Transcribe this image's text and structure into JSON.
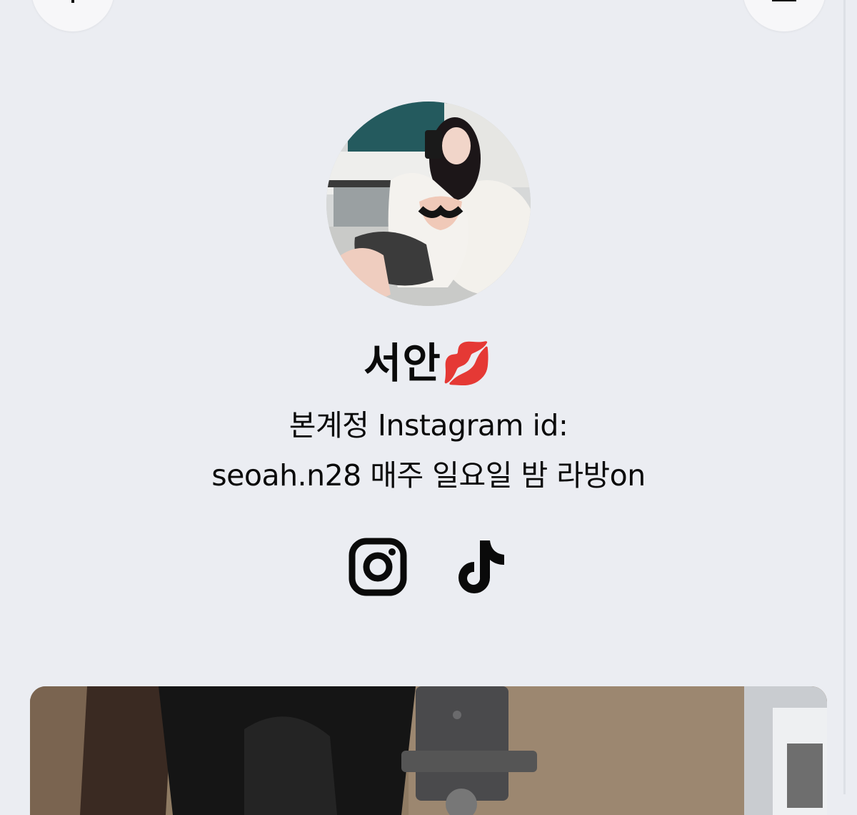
{
  "profile": {
    "display_name": "서안💋",
    "bio_line_1": "본계정 Instagram id:",
    "bio_line_2": "seoah.n28 매주 일요일 밤 라방on"
  },
  "socials": [
    {
      "icon": "instagram-icon"
    },
    {
      "icon": "tiktok-icon"
    }
  ],
  "colors": {
    "page_background": "#ebedf2",
    "text": "#0a0a0a",
    "button_background": "#f7f7f9"
  }
}
